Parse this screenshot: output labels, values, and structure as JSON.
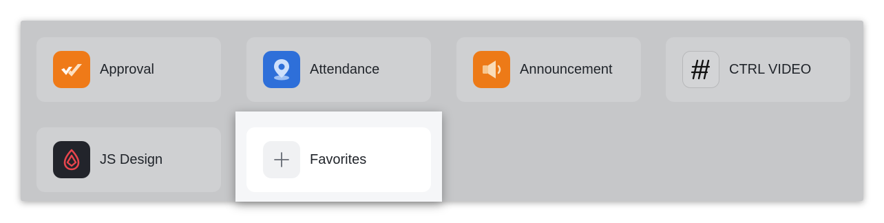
{
  "apps": [
    {
      "label": "Approval",
      "icon": "approval-check-icon",
      "color": "#ef7a18"
    },
    {
      "label": "Attendance",
      "icon": "location-pin-icon",
      "color": "#2e6fd9"
    },
    {
      "label": "Announcement",
      "icon": "megaphone-icon",
      "color": "#ed7a17"
    },
    {
      "label": "CTRL VIDEO",
      "icon": "ctrl-video-logo-icon",
      "color": "#d3d4d6"
    },
    {
      "label": "JS Design",
      "icon": "js-design-logo-icon",
      "color": "#22242b"
    }
  ],
  "favorites": {
    "label": "Favorites",
    "icon": "plus-icon"
  }
}
